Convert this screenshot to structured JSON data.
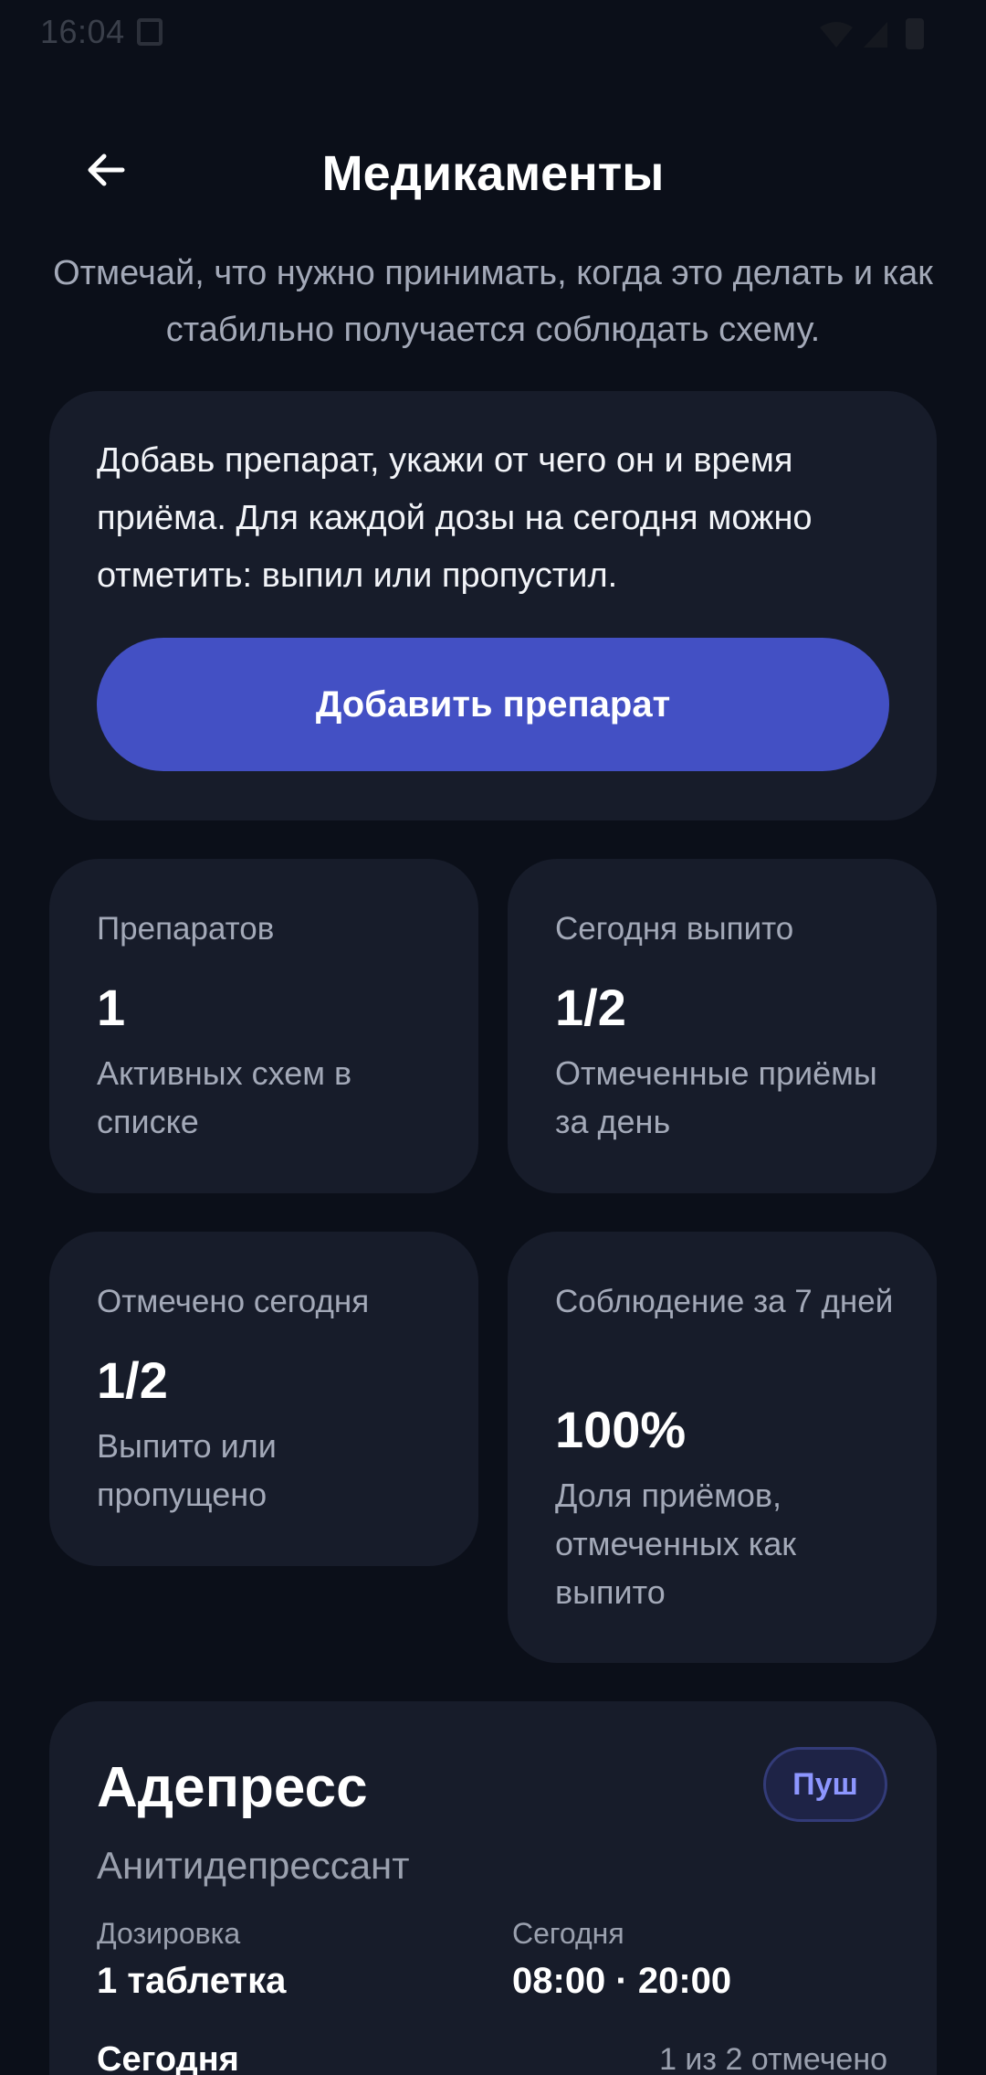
{
  "status_bar": {
    "time": "16:04",
    "icons": [
      "screen-icon",
      "wifi-icon",
      "signal-icon",
      "battery-icon"
    ]
  },
  "header": {
    "back_icon": "arrow-left-icon",
    "title": "Медикаменты",
    "subtitle": "Отмечай, что нужно принимать, когда это делать и как стабильно получается соблюдать схему."
  },
  "intro": {
    "text": "Добавь препарат, укажи от чего он и время приёма. Для каждой дозы на сегодня можно отметить: выпил или пропустил.",
    "add_button_label": "Добавить препарат"
  },
  "stats": [
    {
      "label": "Препаратов",
      "value": "1",
      "description": "Активных схем в списке"
    },
    {
      "label": "Сегодня выпито",
      "value": "1/2",
      "description": "Отмеченные приёмы за день"
    },
    {
      "label": "Отмечено сегодня",
      "value": "1/2",
      "description": "Выпито или пропущено"
    },
    {
      "label": "Соблюдение за 7 дней",
      "value": "100%",
      "description": "Доля приёмов, отмеченных как выпито"
    }
  ],
  "medication": {
    "name": "Адепресс",
    "badge": "Пуш",
    "category": "Анитидепрессант",
    "dosage_label": "Дозировка",
    "dosage_value": "1 таблетка",
    "schedule_label": "Сегодня",
    "schedule_value": "08:00 · 20:00",
    "today_heading": "Сегодня",
    "today_progress": "1 из 2 отмечено"
  },
  "colors": {
    "background": "#0b0f19",
    "card": "#171c2a",
    "accent": "#4350c4",
    "muted_text": "#a3a9b8",
    "badge_text": "#8d96ff"
  }
}
